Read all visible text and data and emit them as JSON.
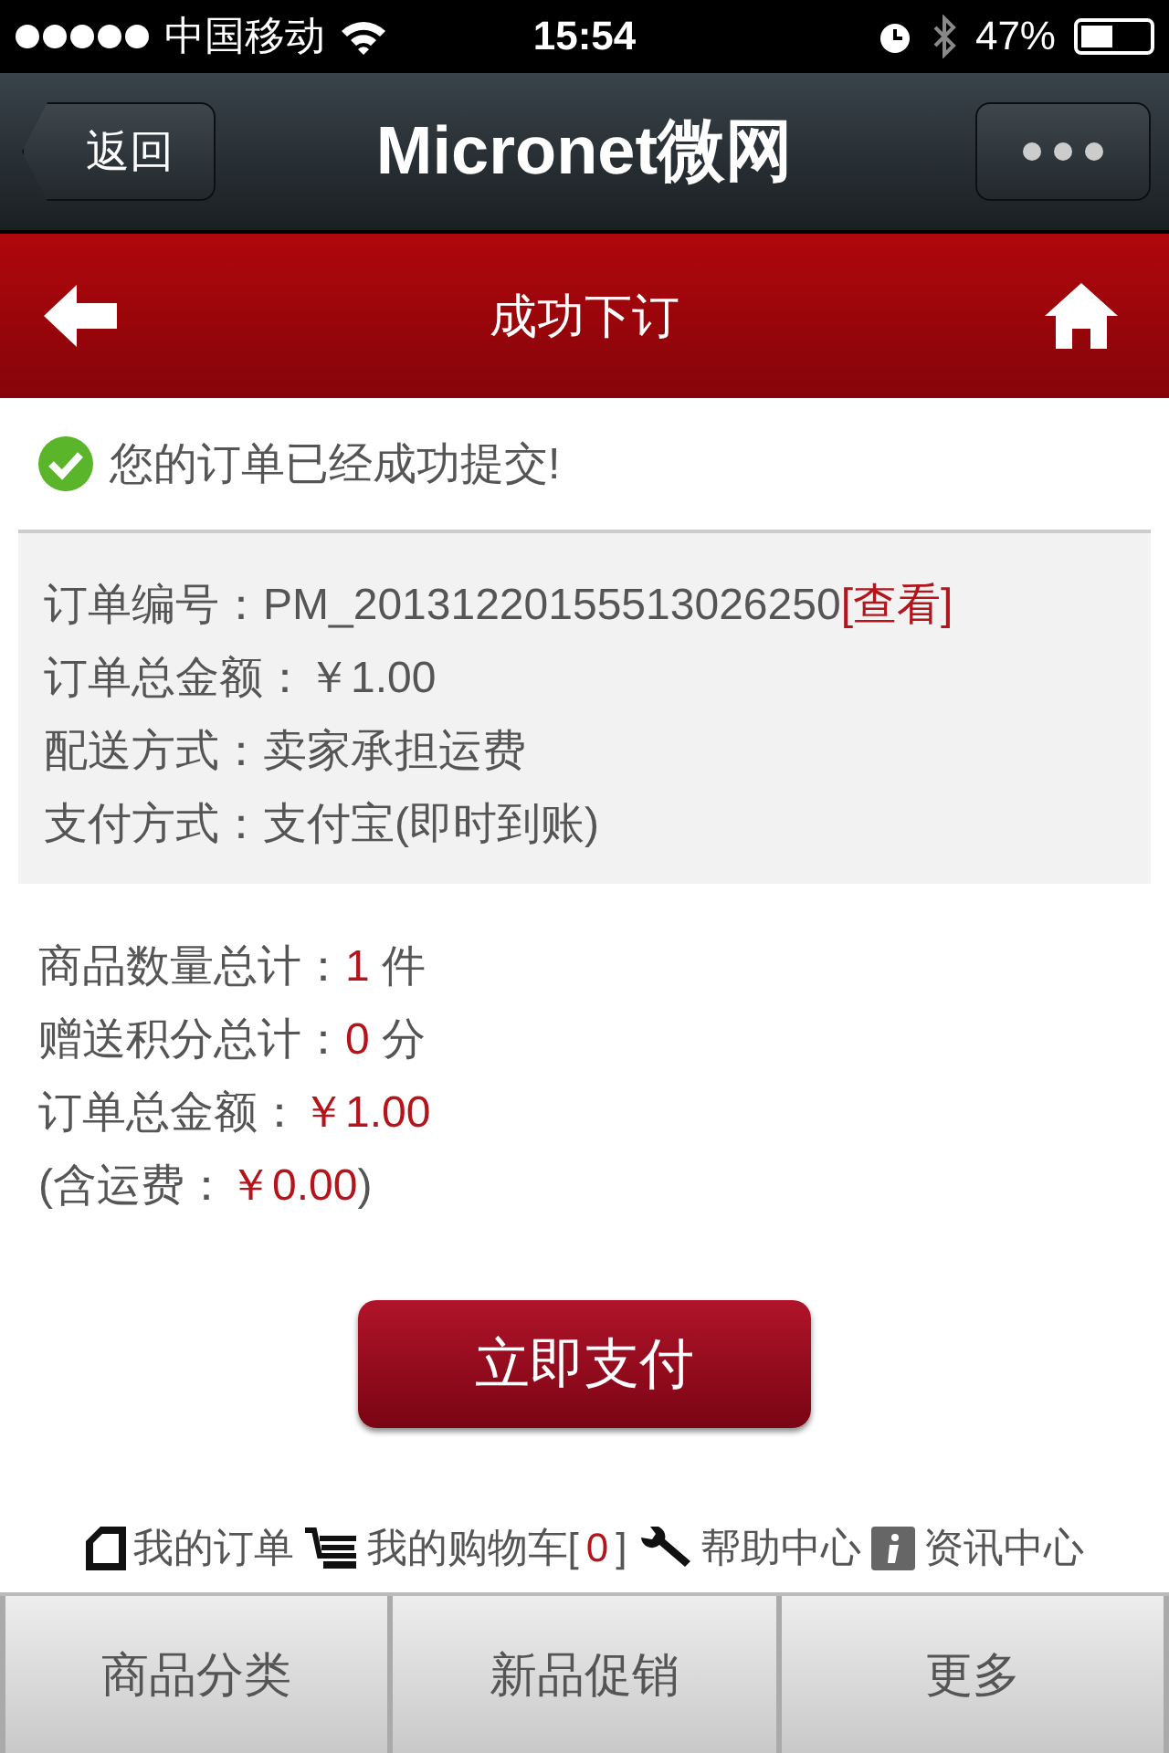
{
  "status_bar": {
    "carrier": "中国移动",
    "time": "15:54",
    "battery": "47%"
  },
  "nav_bar": {
    "back": "返回",
    "title": "Micronet微网"
  },
  "page_header": {
    "title": "成功下订"
  },
  "success_message": "您的订单已经成功提交!",
  "order_info": [
    {
      "label": "订单编号：",
      "value": "PM_20131220155513026250",
      "link": "[查看]"
    },
    {
      "label": "订单总金额：",
      "value": "￥1.00"
    },
    {
      "label": "配送方式：",
      "value": "卖家承担运费"
    },
    {
      "label": "支付方式：",
      "value": "支付宝(即时到账)"
    }
  ],
  "summary": [
    {
      "label": "商品数量总计：",
      "value": "1",
      "unit": " 件"
    },
    {
      "label": "赠送积分总计：",
      "value": "0",
      "unit": " 分"
    },
    {
      "label": "订单总金额：",
      "value": "￥1.00"
    },
    {
      "label": "(含运费：",
      "value": "￥0.00",
      "unit": ")"
    }
  ],
  "pay_button": "立即支付",
  "footer_links": [
    {
      "kind": "order",
      "label": "我的订单"
    },
    {
      "kind": "cart",
      "label": "我的购物车[",
      "count": "0",
      "suffix": "]"
    },
    {
      "kind": "help",
      "label": "帮助中心"
    },
    {
      "kind": "info",
      "label": "资讯中心"
    }
  ],
  "tabs": [
    {
      "label": "商品分类"
    },
    {
      "label": "新品促销"
    },
    {
      "label": "更多"
    }
  ]
}
